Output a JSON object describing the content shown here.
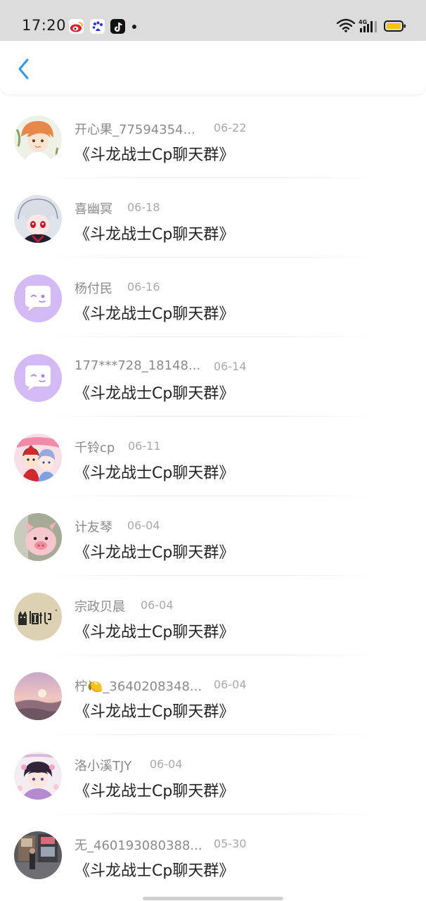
{
  "status_bar": {
    "time": "17:20",
    "app_icons": [
      "weibo-icon",
      "baidu-icon",
      "douyin-icon"
    ],
    "network": "4G",
    "battery_color": "#f6c21c"
  },
  "nav": {
    "back_icon": "chevron-left-icon",
    "accent_color": "#2b9ae8"
  },
  "items": [
    {
      "name": "开心果_77594354...",
      "date": "06-22",
      "message": "《斗龙战士Cp聊天群》",
      "avatar": "anime-girl-orange-hair"
    },
    {
      "name": "喜幽冥",
      "date": "06-18",
      "message": "《斗龙战士Cp聊天群》",
      "avatar": "anime-character-white-hair"
    },
    {
      "name": "杨付民",
      "date": "06-16",
      "message": "《斗龙战士Cp聊天群》",
      "avatar": "default-chat-bubble"
    },
    {
      "name": "177***728_18148...",
      "date": "06-14",
      "message": "《斗龙战士Cp聊天群》",
      "avatar": "default-chat-bubble"
    },
    {
      "name": "千铃cp",
      "date": "06-11",
      "message": "《斗龙战士Cp聊天群》",
      "avatar": "anime-couple"
    },
    {
      "name": "计友琴",
      "date": "06-04",
      "message": "《斗龙战士Cp聊天群》",
      "avatar": "pink-pig-plush"
    },
    {
      "name": "宗政贝晨",
      "date": "06-04",
      "message": "《斗龙战士Cp聊天群》",
      "avatar": "cat-sign"
    },
    {
      "name": "柠🍋_3640208348...",
      "date": "06-04",
      "message": "《斗龙战士Cp聊天群》",
      "avatar": "sunset-landscape"
    },
    {
      "name": "洛小溪TJY",
      "date": "06-04",
      "message": "《斗龙战士Cp聊天群》",
      "avatar": "anime-girl-purple"
    },
    {
      "name": "无_460193080388...",
      "date": "05-30",
      "message": "《斗龙战士Cp聊天群》",
      "avatar": "street-photo"
    }
  ]
}
